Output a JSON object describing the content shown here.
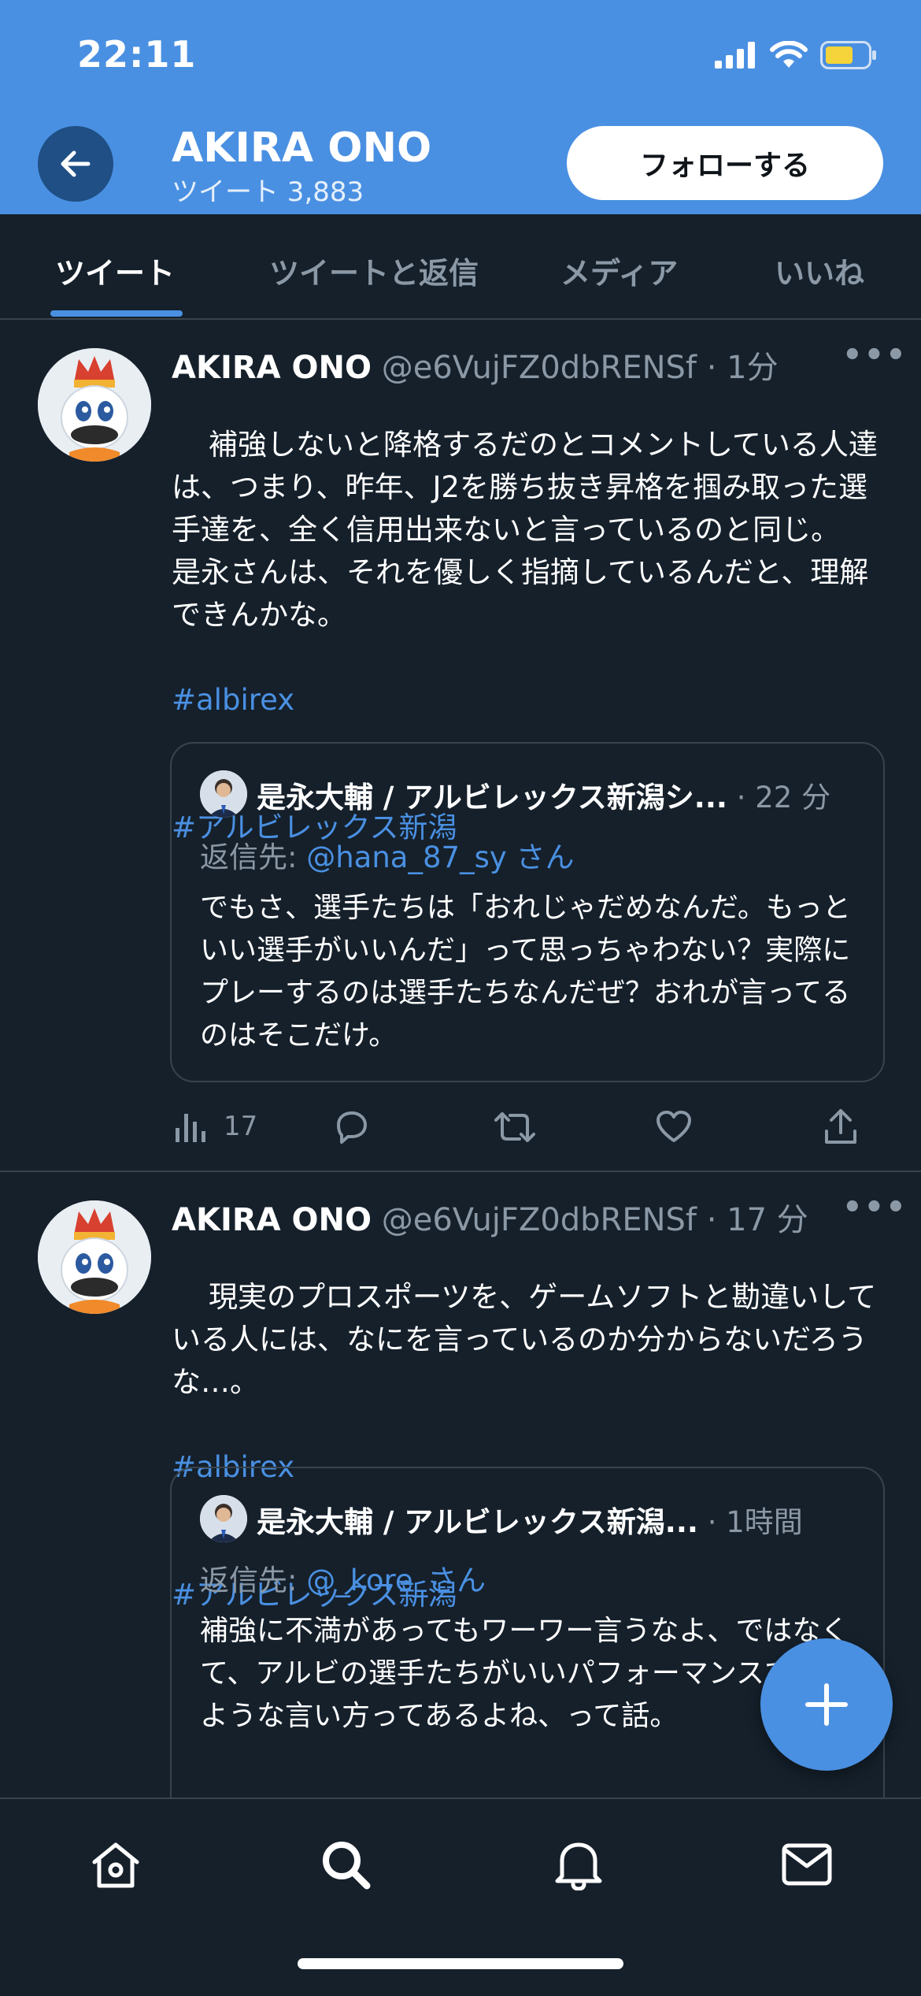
{
  "status_bar": {
    "time": "22:11"
  },
  "header": {
    "name": "AKIRA ONO",
    "tweet_count": "ツイート 3,883",
    "follow_label": "フォローする"
  },
  "tabs": [
    {
      "label": "ツイート",
      "active": true
    },
    {
      "label": "ツイートと返信",
      "active": false
    },
    {
      "label": "メディア",
      "active": false
    },
    {
      "label": "いいね",
      "active": false
    }
  ],
  "tweets": [
    {
      "name": "AKIRA ONO",
      "handle_time": "@e6VujFZ0dbRENSf · 1分",
      "text": "補強しないと降格するだのとコメントしている人達は、つまり、昨年、J2を勝ち抜き昇格を掴み取った選手達を、全く信用出来ないと言っているのと同じ。\n是永さんは、それを優しく指摘しているんだと、理解できんかな。",
      "hashtags": [
        "#albirex",
        "#アルビレックス新潟"
      ],
      "quote": {
        "name": "是永大輔 / アルビレックス新潟シ...",
        "time": "· 22 分",
        "reply_prefix": "返信先: ",
        "reply_to": "@hana_87_sy さん",
        "text": "でもさ、選手たちは「おれじゃだめなんだ。もっといい選手がいいんだ」って思っちゃわない？実際にプレーするのは選手たちなんだぜ？おれが言ってるのはそこだけ。"
      },
      "view_count": "17"
    },
    {
      "name": "AKIRA ONO",
      "handle_time": "@e6VujFZ0dbRENSf · 17 分",
      "text": "現実のプロスポーツを、ゲームソフトと勘違いしている人には、なにを言っているのか分からないだろうな…。",
      "hashtags": [
        "#albirex",
        "#アルビレックス新潟"
      ],
      "quote": {
        "name": "是永大輔 / アルビレックス新潟...",
        "time": "· 1時間",
        "reply_prefix": "返信先: ",
        "reply_to": "@_kore_さん",
        "text": "補強に不満があってもワーワー言うなよ、ではなくて、アルビの選手たちがいいパフォーマンスできるような言い方ってあるよね、って話。"
      }
    }
  ],
  "colors": {
    "accent": "#4a90e2",
    "background": "#15202b",
    "border": "#38444d",
    "muted": "#8b98a5"
  }
}
